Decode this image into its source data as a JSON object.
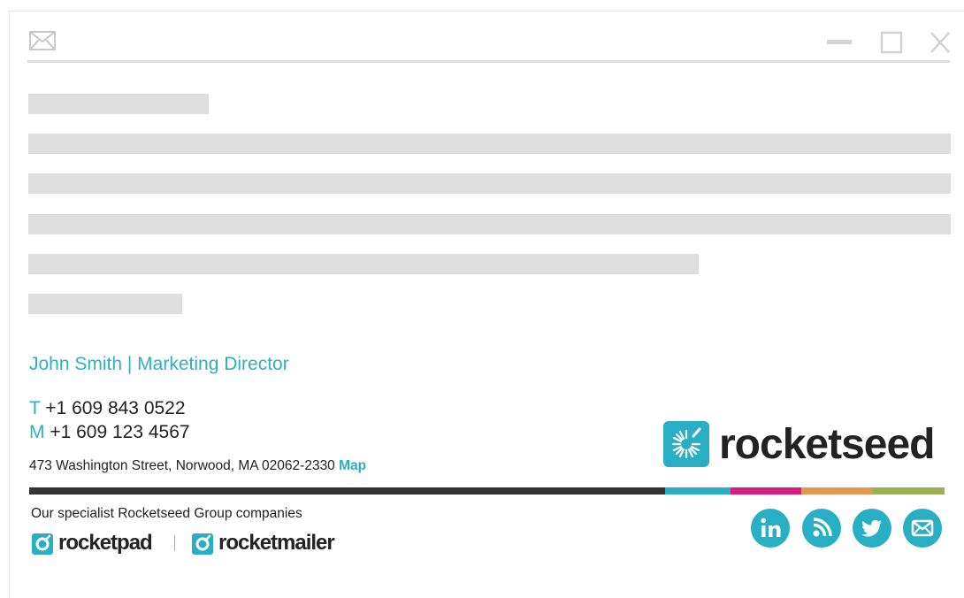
{
  "window": {
    "icons": {
      "app": "envelope-icon",
      "minimize": "minimize-icon",
      "maximize": "maximize-icon",
      "close": "close-icon"
    }
  },
  "signature": {
    "name_title": "John Smith | Marketing Director",
    "phone_label": "T",
    "phone": "+1 609 843 0522",
    "mobile_label": "M",
    "mobile": "+1 609 123 4567",
    "address": "473 Washington Street, Norwood, MA 02062-2330",
    "map_link": "Map",
    "logo_text": "rocketseed",
    "companies_text": "Our specialist Rocketseed Group companies",
    "company_1": "rocketpad",
    "company_2": "rocketmailer",
    "social": [
      "linkedin-icon",
      "rss-icon",
      "twitter-icon",
      "email-icon"
    ]
  },
  "colors": {
    "accent": "#29afc4",
    "bar_dark": "#333333",
    "bar_cyan": "#29afc4",
    "bar_magenta": "#d81b7c",
    "bar_orange": "#e29752",
    "bar_olive": "#9bb055"
  }
}
